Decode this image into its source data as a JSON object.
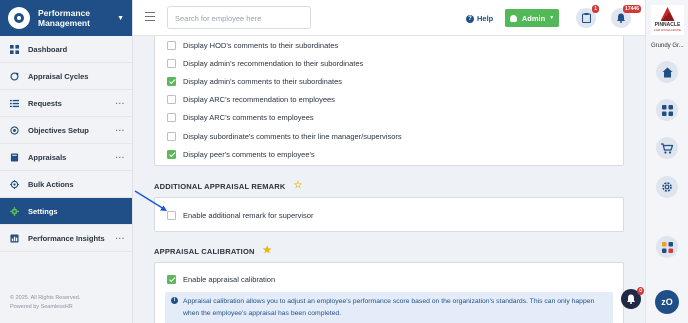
{
  "app": {
    "title_line1": "Performance",
    "title_line2": "Management"
  },
  "sidebar": {
    "items": [
      {
        "label": "Dashboard",
        "icon": "dashboard-icon",
        "has_more": false
      },
      {
        "label": "Appraisal Cycles",
        "icon": "cycle-icon",
        "has_more": false
      },
      {
        "label": "Requests",
        "icon": "list-icon",
        "has_more": true
      },
      {
        "label": "Objectives Setup",
        "icon": "target-icon",
        "has_more": true
      },
      {
        "label": "Appraisals",
        "icon": "book-icon",
        "has_more": true
      },
      {
        "label": "Bulk Actions",
        "icon": "crosshair-icon",
        "has_more": false
      },
      {
        "label": "Settings",
        "icon": "gear-icon",
        "has_more": false,
        "active": true
      },
      {
        "label": "Performance Insights",
        "icon": "chart-icon",
        "has_more": true
      }
    ],
    "footer_line1": "© 2025. All Rights Reserved.",
    "footer_line2": "Powered by SeamlessHR"
  },
  "header": {
    "search_placeholder": "Search for employee here",
    "help_label": "Help",
    "admin_label": "Admin",
    "clipboard_badge": "1",
    "notifications_badge": "17446"
  },
  "rail": {
    "brand_name": "PINNACLE",
    "brand_sub": "FOR EXCELLENCE",
    "company": "Grundy Gr..."
  },
  "main": {
    "comment_options": [
      {
        "label": "Display HOD's comments to their subordinates",
        "checked": false
      },
      {
        "label": "Display admin's recommendation to their subordinates",
        "checked": false
      },
      {
        "label": "Display admin's comments to their subordinates",
        "checked": true
      },
      {
        "label": "Display ARC's recommendation to employees",
        "checked": false
      },
      {
        "label": "Display ARC's comments to employees",
        "checked": false
      },
      {
        "label": "Display subordinate's comments to their line manager/supervisors",
        "checked": false
      },
      {
        "label": "Display peer's comments to employee's",
        "checked": true
      }
    ],
    "remark_section": {
      "title": "ADDITIONAL APPRAISAL REMARK",
      "star_filled": false,
      "option_label": "Enable additional remark for supervisor",
      "option_checked": false
    },
    "calibration_section": {
      "title": "APPRAISAL CALIBRATION",
      "star_filled": true,
      "option_label": "Enable appraisal calibration",
      "option_checked": true,
      "info_text": "Appraisal calibration allows you to adjust an employee's performance score based on the organization's standards. This can only happen when the employee's appraisal has been completed."
    }
  },
  "floating": {
    "bell_badge": "0",
    "avatar_initials": "zO"
  },
  "colors": {
    "brand": "#1f4f86",
    "success": "#53b858",
    "danger": "#d23a3a",
    "star_outline": "#f0c040",
    "star_filled": "#f0b400"
  }
}
